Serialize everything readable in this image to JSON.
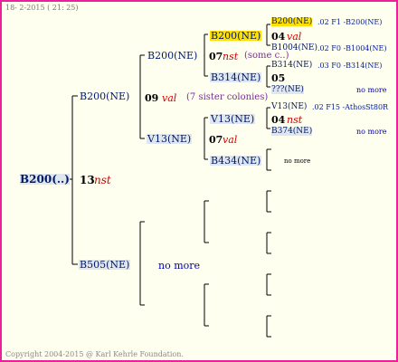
{
  "header": {
    "date": "18-  2-2015 ( 21: 25)"
  },
  "footer": {
    "copyright": "Copyright 2004-2015 @ Karl Kehrle Foundation."
  },
  "root": {
    "label": "B200(..)",
    "num": "13",
    "rel": "nst"
  },
  "gen1": [
    {
      "label": "B200(NE)",
      "num": "09",
      "rel": "val",
      "note": "(7 sister colonies)"
    },
    {
      "label": "B505(NE)",
      "nomore": "no more"
    }
  ],
  "gen2": [
    {
      "label": "B200(NE)",
      "num": "07",
      "rel": "nst",
      "note": "(some c..)"
    },
    {
      "label": "V13(NE)",
      "num": "07",
      "rel": "val"
    }
  ],
  "gen3": [
    {
      "label": "B200(NE)",
      "num": "04",
      "rel": "val"
    },
    {
      "label": "B314(NE)",
      "num": "05"
    },
    {
      "label": "V13(NE)",
      "num": "04",
      "rel": "nst"
    },
    {
      "label": "B434(NE)",
      "nomore": "no more"
    }
  ],
  "gen4": [
    {
      "label": "B200(NE)",
      "info": ".02    F1 -B200(NE)"
    },
    {
      "label": "B1004(NE)",
      "info": ".02  F0 -B1004(NE)"
    },
    {
      "label": "B314(NE)",
      "info": ".03    F0 -B314(NE)"
    },
    {
      "label": "???(NE)",
      "nomore": "no more"
    },
    {
      "label": "V13(NE)",
      "info": ".02 F15 -AthosSt80R"
    },
    {
      "label": "B374(NE)",
      "nomore": "no more"
    }
  ],
  "colors": {
    "border": "#ee1f9a",
    "background": "#fffff0",
    "highlight": "#ffe000",
    "relation": "#d00000"
  }
}
